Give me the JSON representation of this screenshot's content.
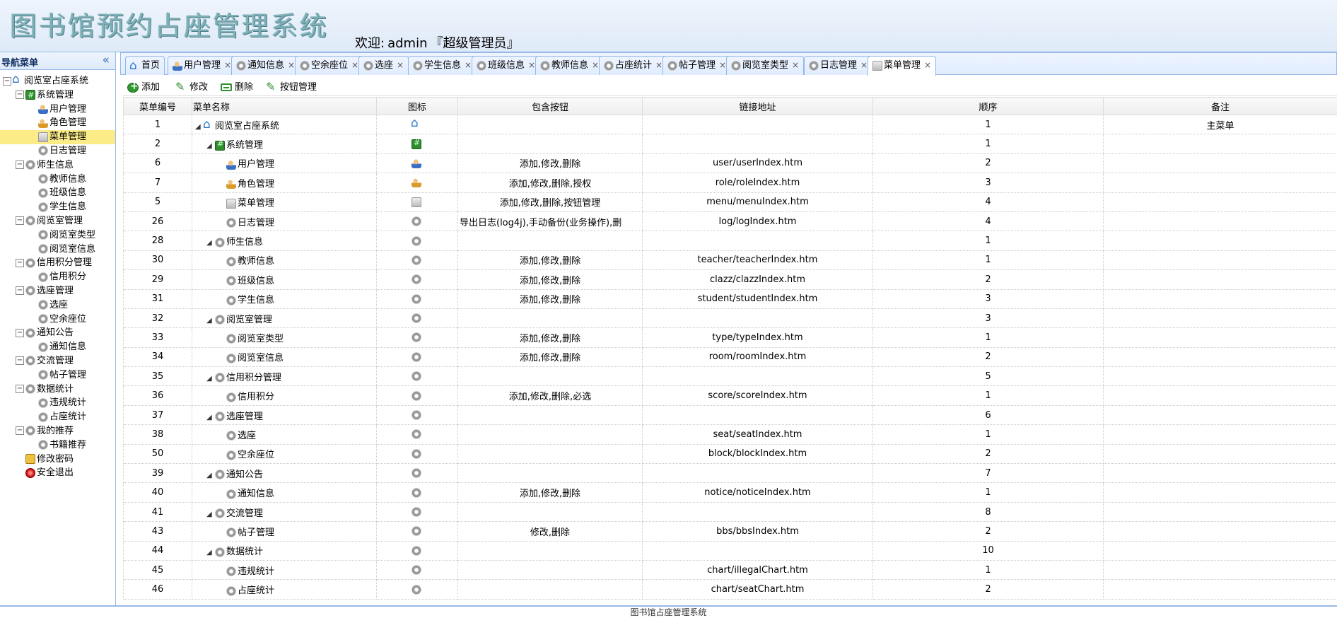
{
  "app": {
    "title": "图书馆预约占座管理系统",
    "welcome_prefix": "欢迎:",
    "user": "admin",
    "role": "『超级管理员』"
  },
  "sidebar": {
    "header": "导航菜单",
    "collapse_icon": "«",
    "tree": [
      {
        "label": "阅览室占座系统",
        "level": 0,
        "icon": "home",
        "toggle": "−"
      },
      {
        "label": "系统管理",
        "level": 1,
        "icon": "green",
        "toggle": "−"
      },
      {
        "label": "用户管理",
        "level": 2,
        "icon": "user"
      },
      {
        "label": "角色管理",
        "level": 2,
        "icon": "role"
      },
      {
        "label": "菜单管理",
        "level": 2,
        "icon": "menu",
        "selected": true
      },
      {
        "label": "日志管理",
        "level": 2,
        "icon": "gear"
      },
      {
        "label": "师生信息",
        "level": 1,
        "icon": "gear",
        "toggle": "−"
      },
      {
        "label": "教师信息",
        "level": 2,
        "icon": "gear"
      },
      {
        "label": "班级信息",
        "level": 2,
        "icon": "gear"
      },
      {
        "label": "学生信息",
        "level": 2,
        "icon": "gear"
      },
      {
        "label": "阅览室管理",
        "level": 1,
        "icon": "gear",
        "toggle": "−"
      },
      {
        "label": "阅览室类型",
        "level": 2,
        "icon": "gear"
      },
      {
        "label": "阅览室信息",
        "level": 2,
        "icon": "gear"
      },
      {
        "label": "信用积分管理",
        "level": 1,
        "icon": "gear",
        "toggle": "−"
      },
      {
        "label": "信用积分",
        "level": 2,
        "icon": "gear"
      },
      {
        "label": "选座管理",
        "level": 1,
        "icon": "gear",
        "toggle": "−"
      },
      {
        "label": "选座",
        "level": 2,
        "icon": "gear"
      },
      {
        "label": "空余座位",
        "level": 2,
        "icon": "gear"
      },
      {
        "label": "通知公告",
        "level": 1,
        "icon": "gear",
        "toggle": "−"
      },
      {
        "label": "通知信息",
        "level": 2,
        "icon": "gear"
      },
      {
        "label": "交流管理",
        "level": 1,
        "icon": "gear",
        "toggle": "−"
      },
      {
        "label": "帖子管理",
        "level": 2,
        "icon": "gear"
      },
      {
        "label": "数据统计",
        "level": 1,
        "icon": "gear",
        "toggle": "−"
      },
      {
        "label": "违规统计",
        "level": 2,
        "icon": "gear"
      },
      {
        "label": "占座统计",
        "level": 2,
        "icon": "gear"
      },
      {
        "label": "我的推荐",
        "level": 1,
        "icon": "gear",
        "toggle": "−"
      },
      {
        "label": "书籍推荐",
        "level": 2,
        "icon": "gear"
      },
      {
        "label": "修改密码",
        "level": 1,
        "icon": "key"
      },
      {
        "label": "安全退出",
        "level": 1,
        "icon": "exit"
      }
    ]
  },
  "tabs": [
    {
      "label": "首页",
      "icon": "home",
      "closable": false
    },
    {
      "label": "用户管理",
      "icon": "user",
      "closable": true
    },
    {
      "label": "通知信息",
      "icon": "gear",
      "closable": true
    },
    {
      "label": "空余座位",
      "icon": "gear",
      "closable": true
    },
    {
      "label": "选座",
      "icon": "gear",
      "closable": true
    },
    {
      "label": "学生信息",
      "icon": "gear",
      "closable": true
    },
    {
      "label": "班级信息",
      "icon": "gear",
      "closable": true
    },
    {
      "label": "教师信息",
      "icon": "gear",
      "closable": true
    },
    {
      "label": "占座统计",
      "icon": "gear",
      "closable": true
    },
    {
      "label": "帖子管理",
      "icon": "gear",
      "closable": true
    },
    {
      "label": "阅览室类型",
      "icon": "gear",
      "closable": true
    },
    {
      "label": "日志管理",
      "icon": "gear",
      "closable": true
    },
    {
      "label": "菜单管理",
      "icon": "menu",
      "closable": true,
      "active": true
    }
  ],
  "tab_close": "×",
  "toolbar": {
    "add": "添加",
    "edit": "修改",
    "delete": "删除",
    "buttons": "按钮管理"
  },
  "grid": {
    "columns": [
      "菜单编号",
      "菜单名称",
      "图标",
      "包含按钮",
      "链接地址",
      "顺序",
      "备注"
    ],
    "rows": [
      {
        "id": "1",
        "name": "阅览室占座系统",
        "depth": 0,
        "expand": true,
        "icon": "home",
        "buttons": "",
        "url": "",
        "order": "1",
        "remark": "主菜单"
      },
      {
        "id": "2",
        "name": "系统管理",
        "depth": 1,
        "expand": true,
        "icon": "green",
        "buttons": "",
        "url": "",
        "order": "1",
        "remark": ""
      },
      {
        "id": "6",
        "name": "用户管理",
        "depth": 2,
        "icon": "user",
        "buttons": "添加,修改,删除",
        "url": "user/userIndex.htm",
        "order": "2",
        "remark": ""
      },
      {
        "id": "7",
        "name": "角色管理",
        "depth": 2,
        "icon": "role",
        "buttons": "添加,修改,删除,授权",
        "url": "role/roleIndex.htm",
        "order": "3",
        "remark": ""
      },
      {
        "id": "5",
        "name": "菜单管理",
        "depth": 2,
        "icon": "menu",
        "buttons": "添加,修改,删除,按钮管理",
        "url": "menu/menuIndex.htm",
        "order": "4",
        "remark": ""
      },
      {
        "id": "26",
        "name": "日志管理",
        "depth": 2,
        "icon": "gear",
        "buttons": "导出日志(log4j),手动备份(业务操作),删",
        "url": "log/logIndex.htm",
        "order": "4",
        "remark": ""
      },
      {
        "id": "28",
        "name": "师生信息",
        "depth": 1,
        "expand": true,
        "icon": "gear",
        "buttons": "",
        "url": "",
        "order": "1",
        "remark": ""
      },
      {
        "id": "30",
        "name": "教师信息",
        "depth": 2,
        "icon": "gear",
        "buttons": "添加,修改,删除",
        "url": "teacher/teacherIndex.htm",
        "order": "1",
        "remark": ""
      },
      {
        "id": "29",
        "name": "班级信息",
        "depth": 2,
        "icon": "gear",
        "buttons": "添加,修改,删除",
        "url": "clazz/clazzIndex.htm",
        "order": "2",
        "remark": ""
      },
      {
        "id": "31",
        "name": "学生信息",
        "depth": 2,
        "icon": "gear",
        "buttons": "添加,修改,删除",
        "url": "student/studentIndex.htm",
        "order": "3",
        "remark": ""
      },
      {
        "id": "32",
        "name": "阅览室管理",
        "depth": 1,
        "expand": true,
        "icon": "gear",
        "buttons": "",
        "url": "",
        "order": "3",
        "remark": ""
      },
      {
        "id": "33",
        "name": "阅览室类型",
        "depth": 2,
        "icon": "gear",
        "buttons": "添加,修改,删除",
        "url": "type/typeIndex.htm",
        "order": "1",
        "remark": ""
      },
      {
        "id": "34",
        "name": "阅览室信息",
        "depth": 2,
        "icon": "gear",
        "buttons": "添加,修改,删除",
        "url": "room/roomIndex.htm",
        "order": "2",
        "remark": ""
      },
      {
        "id": "35",
        "name": "信用积分管理",
        "depth": 1,
        "expand": true,
        "icon": "gear",
        "buttons": "",
        "url": "",
        "order": "5",
        "remark": ""
      },
      {
        "id": "36",
        "name": "信用积分",
        "depth": 2,
        "icon": "gear",
        "buttons": "添加,修改,删除,必选",
        "url": "score/scoreIndex.htm",
        "order": "1",
        "remark": ""
      },
      {
        "id": "37",
        "name": "选座管理",
        "depth": 1,
        "expand": true,
        "icon": "gear",
        "buttons": "",
        "url": "",
        "order": "6",
        "remark": ""
      },
      {
        "id": "38",
        "name": "选座",
        "depth": 2,
        "icon": "gear",
        "buttons": "",
        "url": "seat/seatIndex.htm",
        "order": "1",
        "remark": ""
      },
      {
        "id": "50",
        "name": "空余座位",
        "depth": 2,
        "icon": "gear",
        "buttons": "",
        "url": "block/blockIndex.htm",
        "order": "2",
        "remark": ""
      },
      {
        "id": "39",
        "name": "通知公告",
        "depth": 1,
        "expand": true,
        "icon": "gear",
        "buttons": "",
        "url": "",
        "order": "7",
        "remark": ""
      },
      {
        "id": "40",
        "name": "通知信息",
        "depth": 2,
        "icon": "gear",
        "buttons": "添加,修改,删除",
        "url": "notice/noticeIndex.htm",
        "order": "1",
        "remark": ""
      },
      {
        "id": "41",
        "name": "交流管理",
        "depth": 1,
        "expand": true,
        "icon": "gear",
        "buttons": "",
        "url": "",
        "order": "8",
        "remark": ""
      },
      {
        "id": "43",
        "name": "帖子管理",
        "depth": 2,
        "icon": "gear",
        "buttons": "修改,删除",
        "url": "bbs/bbsIndex.htm",
        "order": "2",
        "remark": ""
      },
      {
        "id": "44",
        "name": "数据统计",
        "depth": 1,
        "expand": true,
        "icon": "gear",
        "buttons": "",
        "url": "",
        "order": "10",
        "remark": ""
      },
      {
        "id": "45",
        "name": "违规统计",
        "depth": 2,
        "icon": "gear",
        "buttons": "",
        "url": "chart/illegalChart.htm",
        "order": "1",
        "remark": ""
      },
      {
        "id": "46",
        "name": "占座统计",
        "depth": 2,
        "icon": "gear",
        "buttons": "",
        "url": "chart/seatChart.htm",
        "order": "2",
        "remark": ""
      }
    ]
  },
  "footer": "图书馆占座管理系统"
}
